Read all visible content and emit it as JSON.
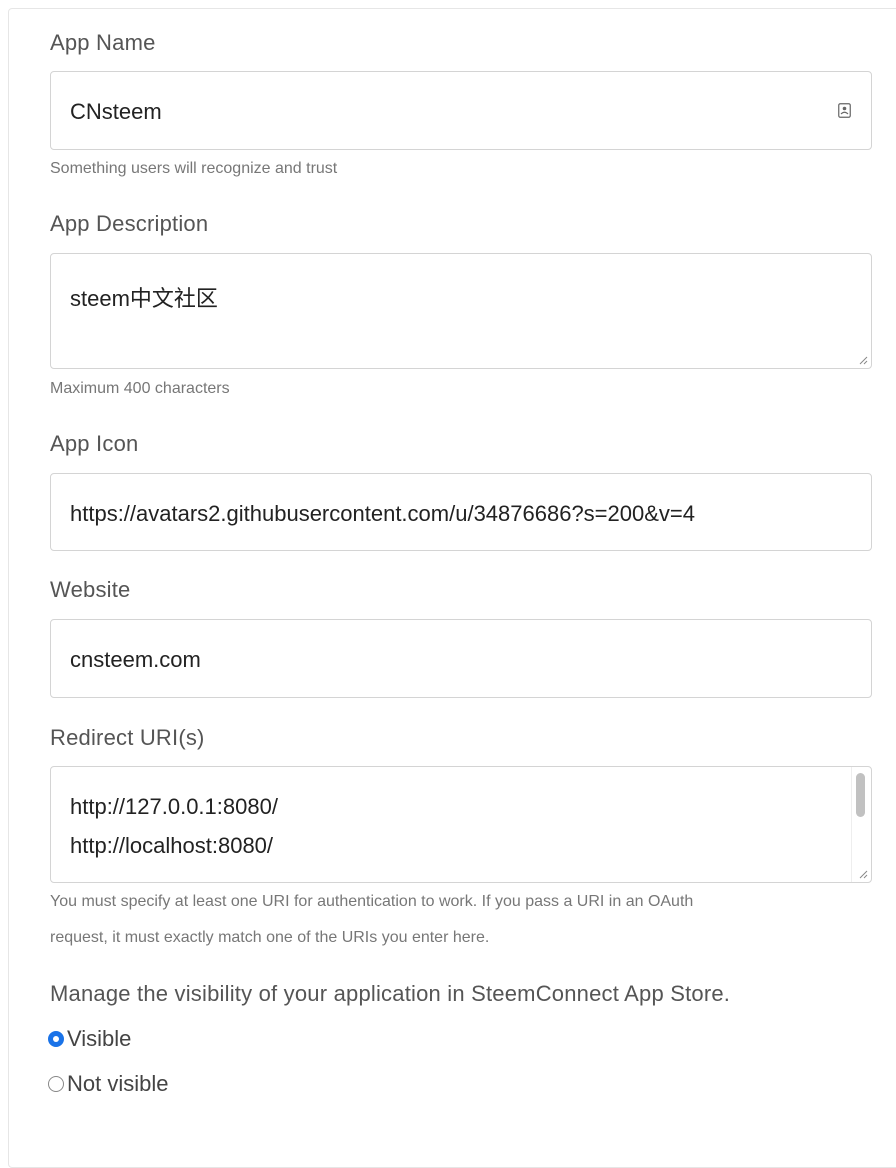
{
  "app_name": {
    "label": "App Name",
    "value": "CNsteem",
    "help": "Something users will recognize and trust",
    "icon": "contact-card-icon"
  },
  "app_description": {
    "label": "App Description",
    "value": "steem中文社区",
    "help": "Maximum 400 characters"
  },
  "app_icon": {
    "label": "App Icon",
    "value": "https://avatars2.githubusercontent.com/u/34876686?s=200&v=4"
  },
  "website": {
    "label": "Website",
    "value": "cnsteem.com"
  },
  "redirect_uris": {
    "label": "Redirect URI(s)",
    "lines": [
      "http://127.0.0.1:8080/",
      "http://localhost:8080/"
    ],
    "help_lines": [
      "You must specify at least one URI for authentication to work. If you pass a URI in an OAuth",
      "request, it must exactly match one of the URIs you enter here."
    ]
  },
  "visibility": {
    "heading": "Manage the visibility of your application in SteemConnect App Store.",
    "options": [
      {
        "label": "Visible",
        "selected": true
      },
      {
        "label": "Not visible",
        "selected": false
      }
    ]
  },
  "colors": {
    "accent": "#1a73e8",
    "border": "#d4d4d4",
    "label": "#555555",
    "help": "#777777"
  }
}
